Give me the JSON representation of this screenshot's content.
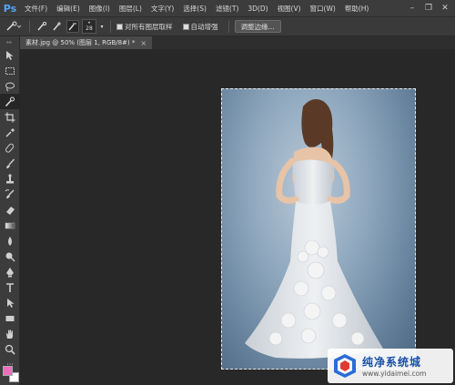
{
  "app": {
    "logo": "Ps"
  },
  "menu": [
    "文件(F)",
    "编辑(E)",
    "图像(I)",
    "图层(L)",
    "文字(Y)",
    "选择(S)",
    "滤镜(T)",
    "3D(D)",
    "视图(V)",
    "窗口(W)",
    "帮助(H)"
  ],
  "window_controls": {
    "minimize": "–",
    "restore": "❐",
    "close": "✕"
  },
  "options": {
    "brush_size": "28",
    "sample_all_layers": "对所有图层取样",
    "auto_enhance": "自动增强",
    "refine_edge": "调整边缘..."
  },
  "document_tab": {
    "title": "素材.jpg @ 50% (图层 1, RGB/8#) *",
    "close": "×"
  },
  "colors": {
    "foreground": "#f06dbb",
    "background": "#ffffff"
  },
  "watermark": {
    "title": "纯净系统城",
    "url": "www.yidaimei.com"
  }
}
